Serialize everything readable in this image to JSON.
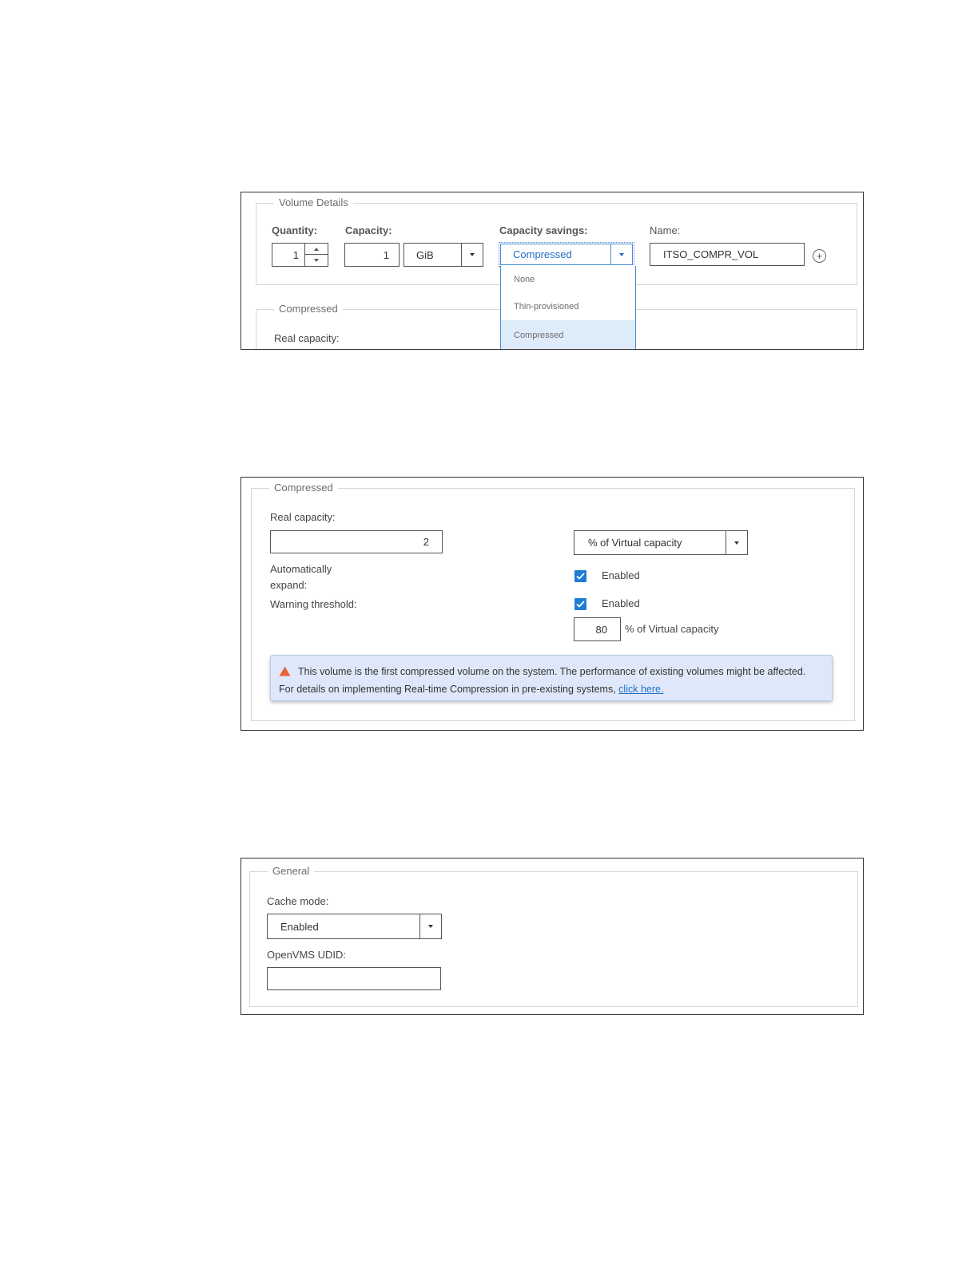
{
  "shot1": {
    "legend": "Volume Details",
    "quantity": {
      "label": "Quantity:",
      "value": "1"
    },
    "capacity": {
      "label": "Capacity:",
      "value": "1",
      "unit": "GiB"
    },
    "capacity_savings": {
      "label": "Capacity savings:",
      "selected": "Compressed",
      "options": [
        "None",
        "Thin-provisioned",
        "Compressed"
      ]
    },
    "name": {
      "label": "Name:",
      "value": "ITSO_COMPR_VOL"
    },
    "compressed_legend": "Compressed",
    "real_capacity_label": "Real capacity:"
  },
  "shot2": {
    "legend": "Compressed",
    "real_capacity": {
      "label": "Real capacity:",
      "value": "2",
      "mode": "% of Virtual capacity"
    },
    "auto_expand": {
      "label_line1": "Automatically",
      "label_line2": "expand:",
      "checkbox_label": "Enabled",
      "checked": true
    },
    "warning_threshold": {
      "label": "Warning threshold:",
      "checkbox_label": "Enabled",
      "checked": true,
      "value": "80",
      "unit_label": "% of Virtual capacity"
    },
    "alert": {
      "text": "This volume is the first compressed volume on the system. The performance of existing volumes might be affected. For details on implementing Real-time Compression in pre-existing systems,",
      "link": "click here."
    }
  },
  "shot3": {
    "legend": "General",
    "cache_mode": {
      "label": "Cache mode:",
      "value": "Enabled"
    },
    "openvms_udid": {
      "label": "OpenVMS UDID:",
      "value": ""
    }
  },
  "colors": {
    "accent": "#1f7bd3",
    "selected_text": "#1f6fc4",
    "alert_bg": "#dfe8fa",
    "warning_icon": "#e8653a"
  }
}
